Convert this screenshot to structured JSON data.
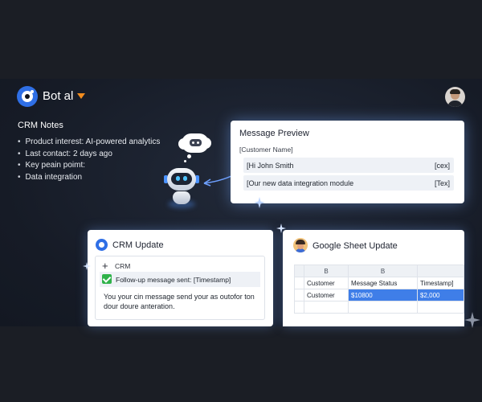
{
  "header": {
    "app_title": "Bot al"
  },
  "notes": {
    "title": "CRM Notes",
    "items": [
      "Product interest: AI-powered analytics",
      "Last contact: 2 days ago",
      "Key peain poimt:",
      "Data integration"
    ]
  },
  "preview": {
    "title": "Message Preview",
    "field": "[Customer Name]",
    "rows": [
      {
        "left": "[Hi John Smith",
        "right": "[cex]"
      },
      {
        "left": "[Our new data integration module",
        "right": "[Tex]"
      }
    ]
  },
  "crm": {
    "title": "CRM Update",
    "plus": "+",
    "label": "CRM",
    "status": "Follow-up message sent: [Timestamp]",
    "message": "You your cin message send your as outofor ton dour doure anteration."
  },
  "sheet": {
    "title": "Google Sheet Update",
    "col_headers": [
      "B",
      "B"
    ],
    "headers": [
      "Customer",
      "Message Status",
      "Timestamp]"
    ],
    "row": [
      "Customer",
      "$10800",
      "$2,000"
    ]
  },
  "colors": {
    "accent": "#2f6fe6",
    "caret": "#f28c1e",
    "success": "#2fb24a",
    "highlight": "#3f7ee8"
  },
  "icons": [
    "bot-logo-icon",
    "caret-down-icon",
    "user-avatar-icon",
    "thought-bubble-icon",
    "robot-icon",
    "plus-icon",
    "check-icon",
    "crm-icon",
    "sheet-avatar-icon"
  ]
}
